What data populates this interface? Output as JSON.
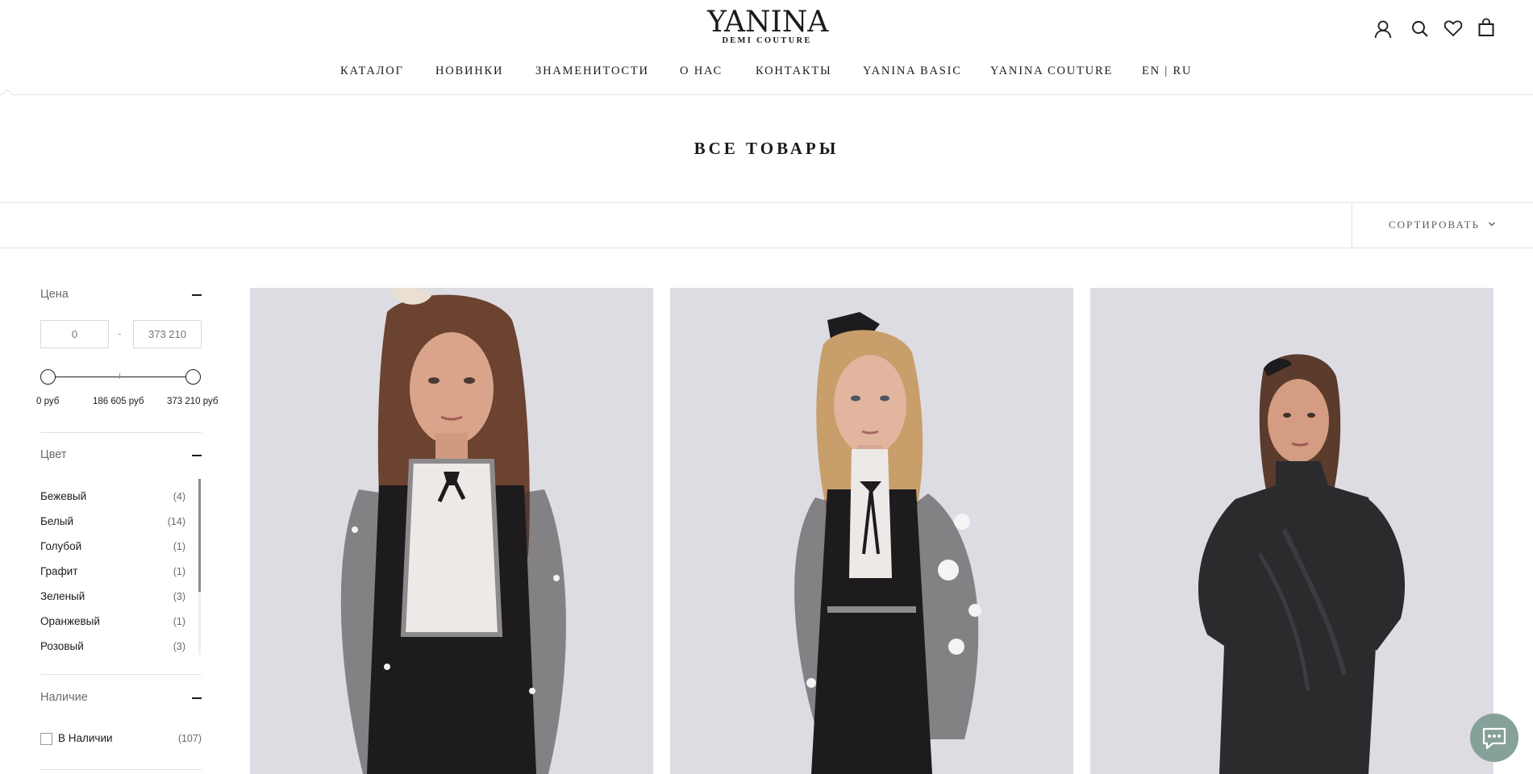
{
  "brand": {
    "name": "YANINA",
    "tagline": "DEMI COUTURE"
  },
  "header": {
    "icons": [
      "account-icon",
      "search-icon",
      "wishlist-icon",
      "cart-icon"
    ]
  },
  "nav": {
    "items": [
      "КАТАЛОГ",
      "НОВИНКИ",
      "ЗНАМЕНИТОСТИ",
      "О НАС",
      "КОНТАКТЫ",
      "YANINA BASIC",
      "YANINA COUTURE",
      "EN | RU"
    ]
  },
  "page": {
    "title": "ВСЕ ТОВАРЫ"
  },
  "toolbar": {
    "sort_label": "СОРТИРОВАТЬ"
  },
  "filters": {
    "price": {
      "title": "Цена",
      "min_placeholder": "0",
      "max_placeholder": "373 210",
      "dash": "-",
      "labels": [
        "0 руб",
        "186 605 руб",
        "373 210 руб"
      ],
      "range_fraction": [
        0,
        1
      ]
    },
    "color": {
      "title": "Цвет",
      "items": [
        {
          "name": "Бежевый",
          "count": "(4)"
        },
        {
          "name": "Белый",
          "count": "(14)"
        },
        {
          "name": "Голубой",
          "count": "(1)"
        },
        {
          "name": "Графит",
          "count": "(1)"
        },
        {
          "name": "Зеленый",
          "count": "(3)"
        },
        {
          "name": "Оранжевый",
          "count": "(1)"
        },
        {
          "name": "Розовый",
          "count": "(3)"
        }
      ]
    },
    "availability": {
      "title": "Наличие",
      "items": [
        {
          "name": "В Наличии",
          "count": "(107)",
          "checked": false
        }
      ]
    }
  },
  "products": [
    {
      "image": "model-black-tulle-dress-white-lace-bib"
    },
    {
      "image": "model-black-velvet-dress-daisy-sleeves"
    },
    {
      "image": "model-dark-glitter-long-sleeve-dress"
    }
  ],
  "colors": {
    "text": "#1c1b1b",
    "muted": "#6a6a6a",
    "border": "#e3e3e3",
    "photo_bg": "#d9d8e0",
    "chat_accent": "#86a19a"
  }
}
